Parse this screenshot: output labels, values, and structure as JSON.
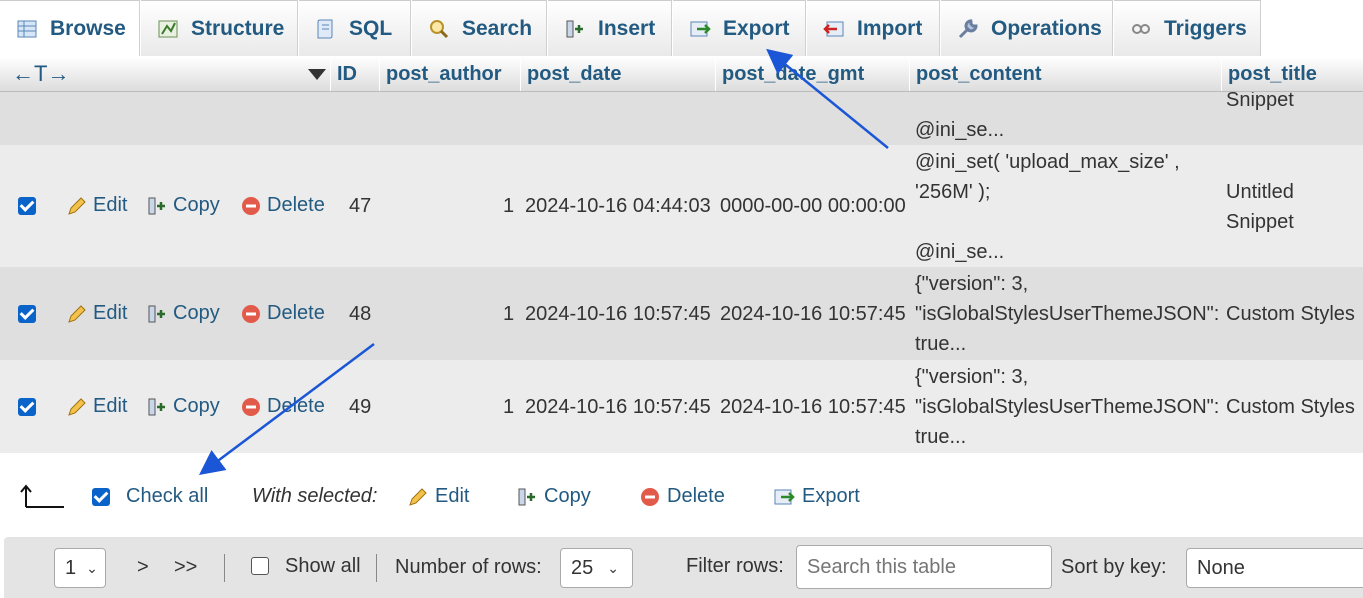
{
  "tabs": [
    {
      "label": "Browse",
      "icon": "table-browse-icon",
      "active": true
    },
    {
      "label": "Structure",
      "icon": "structure-icon"
    },
    {
      "label": "SQL",
      "icon": "sql-icon"
    },
    {
      "label": "Search",
      "icon": "search-icon"
    },
    {
      "label": "Insert",
      "icon": "insert-icon"
    },
    {
      "label": "Export",
      "icon": "export-icon"
    },
    {
      "label": "Import",
      "icon": "import-icon"
    },
    {
      "label": "Operations",
      "icon": "wrench-icon"
    },
    {
      "label": "Triggers",
      "icon": "triggers-icon"
    }
  ],
  "header": {
    "arrows": "←T→",
    "columns": [
      "ID",
      "post_author",
      "post_date",
      "post_date_gmt",
      "post_content",
      "post_title"
    ]
  },
  "actions": {
    "edit": "Edit",
    "copy": "Copy",
    "delete": "Delete"
  },
  "partial_row": {
    "content": "@ini_se...",
    "title": "Snippet"
  },
  "rows": [
    {
      "id": "47",
      "author": "1",
      "date": "2024-10-16 04:44:03",
      "date_gmt": "0000-00-00 00:00:00",
      "content": [
        "@ini_set( 'upload_max_size' ,",
        "'256M' );",
        "",
        "@ini_se..."
      ],
      "title": [
        "Untitled",
        "Snippet"
      ],
      "checked": true
    },
    {
      "id": "48",
      "author": "1",
      "date": "2024-10-16 10:57:45",
      "date_gmt": "2024-10-16 10:57:45",
      "content": [
        "{\"version\": 3,",
        "\"isGlobalStylesUserThemeJSON\":",
        "true..."
      ],
      "title": [
        "Custom Styles"
      ],
      "checked": true
    },
    {
      "id": "49",
      "author": "1",
      "date": "2024-10-16 10:57:45",
      "date_gmt": "2024-10-16 10:57:45",
      "content": [
        "{\"version\": 3,",
        "\"isGlobalStylesUserThemeJSON\":",
        "true..."
      ],
      "title": [
        "Custom Styles"
      ],
      "checked": true
    }
  ],
  "bottom": {
    "check_all": "Check all",
    "with_selected": "With selected:",
    "edit": "Edit",
    "copy": "Copy",
    "delete": "Delete",
    "export": "Export"
  },
  "navigation": {
    "page": "1",
    "next": ">",
    "last": ">>",
    "show_all": "Show all",
    "rows_label": "Number of rows:",
    "rows_value": "25",
    "filter_label": "Filter rows:",
    "filter_placeholder": "Search this table",
    "sort_label": "Sort by key:",
    "sort_value": "None"
  },
  "colors": {
    "link": "#235a81",
    "check": "#0a63c9",
    "annotation": "#1a56d6"
  }
}
